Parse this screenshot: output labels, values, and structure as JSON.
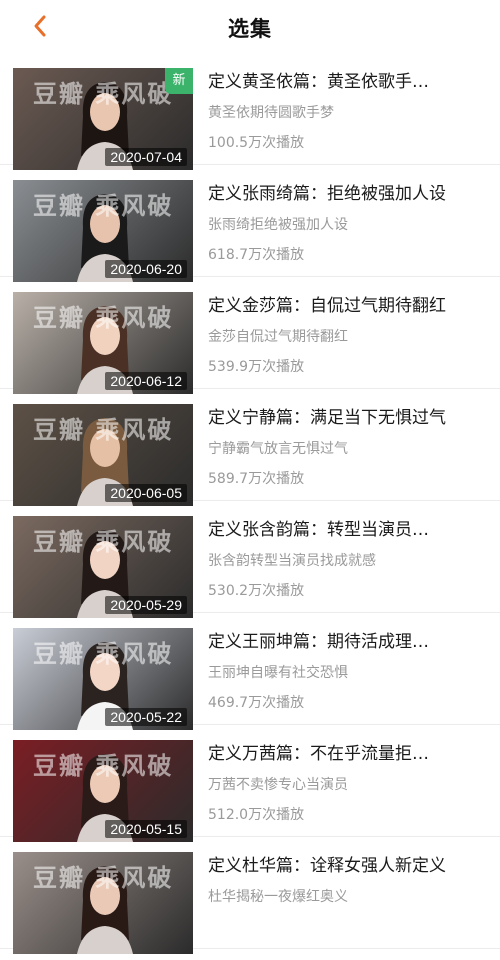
{
  "header": {
    "title": "选集",
    "back_icon": "chevron-left-icon",
    "accent": "#e8702a"
  },
  "watermark": "豆瓣 乘风破",
  "episodes": [
    {
      "title": "定义黄圣依篇：黄圣依歌手…",
      "subtitle": "黄圣依期待圆歌手梦",
      "plays": "100.5万次播放",
      "date": "2020-07-04",
      "badge": "新",
      "bg": "#6b5a52",
      "person": "#1d1512",
      "skin": "#e9c6b0"
    },
    {
      "title": "定义张雨绮篇：拒绝被强加人设",
      "subtitle": "张雨绮拒绝被强加人设",
      "plays": "618.7万次播放",
      "date": "2020-06-20",
      "badge": "",
      "bg": "#8a8e92",
      "person": "#1a1a1a",
      "skin": "#e7c3ad"
    },
    {
      "title": "定义金莎篇：自侃过气期待翻红",
      "subtitle": "金莎自侃过气期待翻红",
      "plays": "539.9万次播放",
      "date": "2020-06-12",
      "badge": "",
      "bg": "#b9b0a8",
      "person": "#4a3025",
      "skin": "#f0d2bf"
    },
    {
      "title": "定义宁静篇：满足当下无惧过气",
      "subtitle": "宁静霸气放言无惧过气",
      "plays": "589.7万次播放",
      "date": "2020-06-05",
      "badge": "",
      "bg": "#5d5146",
      "person": "#7a5b3f",
      "skin": "#e5c0a4"
    },
    {
      "title": "定义张含韵篇：转型当演员…",
      "subtitle": "张含韵转型当演员找成就感",
      "plays": "530.2万次播放",
      "date": "2020-05-29",
      "badge": "",
      "bg": "#7b6a60",
      "person": "#231a17",
      "skin": "#f1d4c4"
    },
    {
      "title": "定义王丽坤篇：期待活成理…",
      "subtitle": "王丽坤自曝有社交恐惧",
      "plays": "469.7万次播放",
      "date": "2020-05-22",
      "badge": "",
      "bg": "#c9cdd6",
      "person": "#2a2320",
      "skin": "#f3d6c5"
    },
    {
      "title": "定义万茜篇：不在乎流量拒…",
      "subtitle": "万茜不卖惨专心当演员",
      "plays": "512.0万次播放",
      "date": "2020-05-15",
      "badge": "",
      "bg": "#7a1e24",
      "person": "#2b1b18",
      "skin": "#eccab6"
    },
    {
      "title": "定义杜华篇：诠释女强人新定义",
      "subtitle": "杜华揭秘一夜爆红奥义",
      "plays": "",
      "date": "",
      "badge": "",
      "bg": "#9a8f8a",
      "person": "#2a1a16",
      "skin": "#eac9b7"
    }
  ]
}
